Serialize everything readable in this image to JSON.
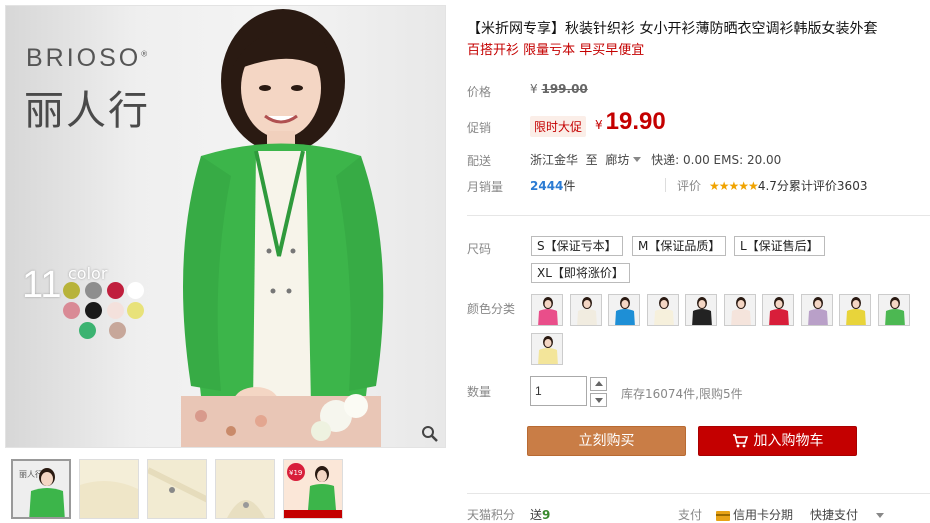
{
  "gallery": {
    "brand": "BRIOSO",
    "brand_mark": "®",
    "brand_cn": "丽人行",
    "color_count": "11",
    "color_word": "color",
    "color_dots": [
      "#b8b33a",
      "#8e8e8e",
      "#c01f3d",
      "#ffffff",
      "#d98a95",
      "#1a1a1a",
      "#f4e1dc",
      "#e8e27a",
      "#3cb371",
      "#c7a79a"
    ],
    "zoom_icon": "magnifier-icon",
    "thumbnail_badge": "¥19"
  },
  "product": {
    "title": "【米折网专享】秋装针织衫 女小开衫薄防晒衣空调衫韩版女装外套",
    "subtitle": "百搭开衫 限量亏本 早买早便宜"
  },
  "price": {
    "label": "价格",
    "currency": "¥",
    "original": "199.00",
    "promo_label": "促销",
    "promo_badge": "限时大促",
    "current": "19.90"
  },
  "shipping": {
    "label": "配送",
    "from": "浙江金华",
    "to_word": "至",
    "destination": "廊坊",
    "fees": "快递: 0.00  EMS: 20.00"
  },
  "sales": {
    "label": "月销量",
    "count": "2444",
    "unit": "件",
    "rating_label": "评价",
    "stars": "★★★★★",
    "score": "4.7分",
    "review_text": "累计评价",
    "review_count": "3603"
  },
  "size": {
    "label": "尺码",
    "options": [
      "S【保证亏本】",
      "M【保证品质】",
      "L【保证售后】",
      "XL【即将涨价】"
    ]
  },
  "color": {
    "label": "颜色分类",
    "swatches": [
      "#e94e8a",
      "#f1ece0",
      "#1e8fd6",
      "#f6f0dc",
      "#222222",
      "#f5e4dc",
      "#d81e3a",
      "#b9a0c8",
      "#e8d43a",
      "#4cb852",
      "#f3e59a"
    ]
  },
  "quantity": {
    "label": "数量",
    "value": "1",
    "stock": "库存16074件,限购5件"
  },
  "actions": {
    "buy_now": "立刻购买",
    "add_to_cart": "加入购物车"
  },
  "footer": {
    "points_label": "天猫积分",
    "points_prefix": "送",
    "points_value": "9",
    "pay_label": "支付",
    "card_pay": "信用卡分期",
    "quick_pay": "快捷支付"
  },
  "colors": {
    "accent_red": "#c40000",
    "buy_orange": "#c97d46",
    "link_blue": "#2b7bd3",
    "star_gold": "#f0a300"
  }
}
